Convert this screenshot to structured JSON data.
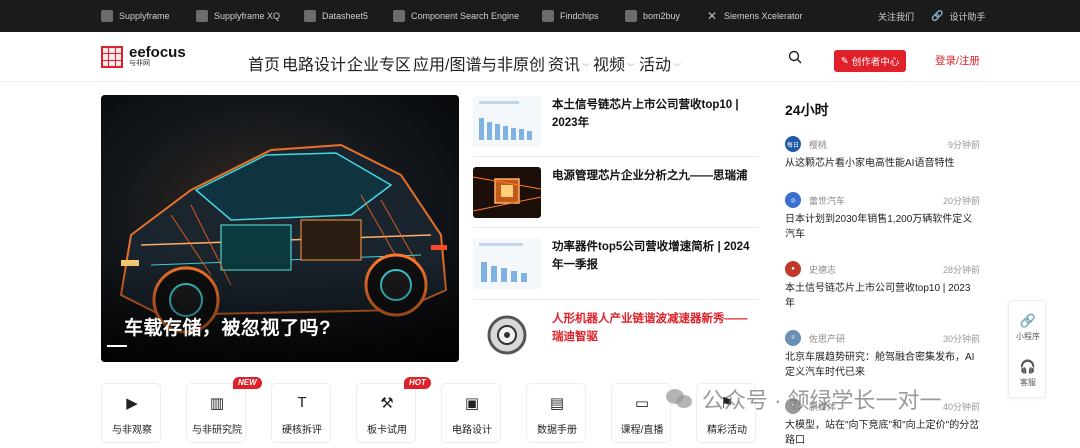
{
  "topbar": {
    "links": [
      {
        "label": "Supplyframe",
        "icon": "supplyframe-icon"
      },
      {
        "label": "Supplyframe XQ",
        "icon": "supplyframe-xq-icon"
      },
      {
        "label": "Datasheet5",
        "icon": "datasheet5-icon"
      },
      {
        "label": "Component Search Engine",
        "icon": "component-search-icon"
      },
      {
        "label": "Findchips",
        "icon": "findchips-icon"
      },
      {
        "label": "bom2buy",
        "icon": "bom2buy-icon"
      },
      {
        "label": "Siemens Xcelerator",
        "icon": "siemens-x-icon"
      }
    ],
    "about": "关注我们",
    "design_assistant": "设计助手"
  },
  "header": {
    "logo_text": "eefocus",
    "logo_sub": "与非网",
    "nav": [
      "首页",
      "电路设计",
      "企业专区",
      "应用/图谱",
      "与非原创",
      "资讯",
      "视频",
      "活动"
    ],
    "creator_button": "创作者中心",
    "login": "登录/注册"
  },
  "hero": {
    "title": "车载存储，被忽视了吗?",
    "slides": 4,
    "active_slide": 4
  },
  "articles": [
    {
      "title": "本土信号链芯片上市公司营收top10 | 2023年",
      "highlight": false,
      "thumb": "chart-thumb"
    },
    {
      "title": "电源管理芯片企业分析之九——思瑞浦",
      "highlight": false,
      "thumb": "chip-thumb"
    },
    {
      "title": "功率器件top5公司营收增速简析 | 2024年一季报",
      "highlight": false,
      "thumb": "chart-thumb"
    },
    {
      "title": "人形机器人产业链谐波减速器新秀——瑞迪智驱",
      "highlight": true,
      "thumb": "gear-thumb"
    }
  ],
  "h24": {
    "heading": "24小时",
    "items": [
      {
        "author": "樱桃",
        "time": "9分钟前",
        "title": "从这颗芯片看小家电高性能AI语音特性",
        "avatar_color": "#1f5aa6"
      },
      {
        "author": "蕾世汽车",
        "time": "20分钟前",
        "title": "日本计划到2030年销售1,200万辆软件定义汽车",
        "avatar_color": "#3a6fd0"
      },
      {
        "author": "史德志",
        "time": "28分钟前",
        "title": "本土信号链芯片上市公司营收top10 | 2023年",
        "avatar_color": "#c0392b"
      },
      {
        "author": "佐思产研",
        "time": "30分钟前",
        "title": "北京车展趋势研究：舱驾融合密集发布，AI定义汽车时代已来",
        "avatar_color": "#6a8fb5"
      },
      {
        "author": "鹏媒体",
        "time": "40分钟前",
        "title": "大模型，站在\"向下竞底\"和\"向上定价\"的分岔路口",
        "avatar_color": "#999999"
      }
    ]
  },
  "float_bar": {
    "mini_program": "小程序",
    "service": "客服"
  },
  "quick_links": [
    {
      "label": "与非观察",
      "icon": "video-icon",
      "badge": ""
    },
    {
      "label": "与非研究院",
      "icon": "chart-icon",
      "badge": "NEW"
    },
    {
      "label": "硬核拆评",
      "icon": "hammer-icon",
      "badge": ""
    },
    {
      "label": "板卡试用",
      "icon": "tools-icon",
      "badge": "HOT"
    },
    {
      "label": "电路设计",
      "icon": "chip-icon",
      "badge": ""
    },
    {
      "label": "数据手册",
      "icon": "datasheet-icon",
      "badge": ""
    },
    {
      "label": "课程/直播",
      "icon": "monitor-icon",
      "badge": ""
    },
    {
      "label": "精彩活动",
      "icon": "flag-icon",
      "badge": ""
    }
  ],
  "watermark": "公众号 · 领绿学长一对一",
  "colors": {
    "accent": "#e0212a",
    "topbar": "#1b1b1b"
  }
}
